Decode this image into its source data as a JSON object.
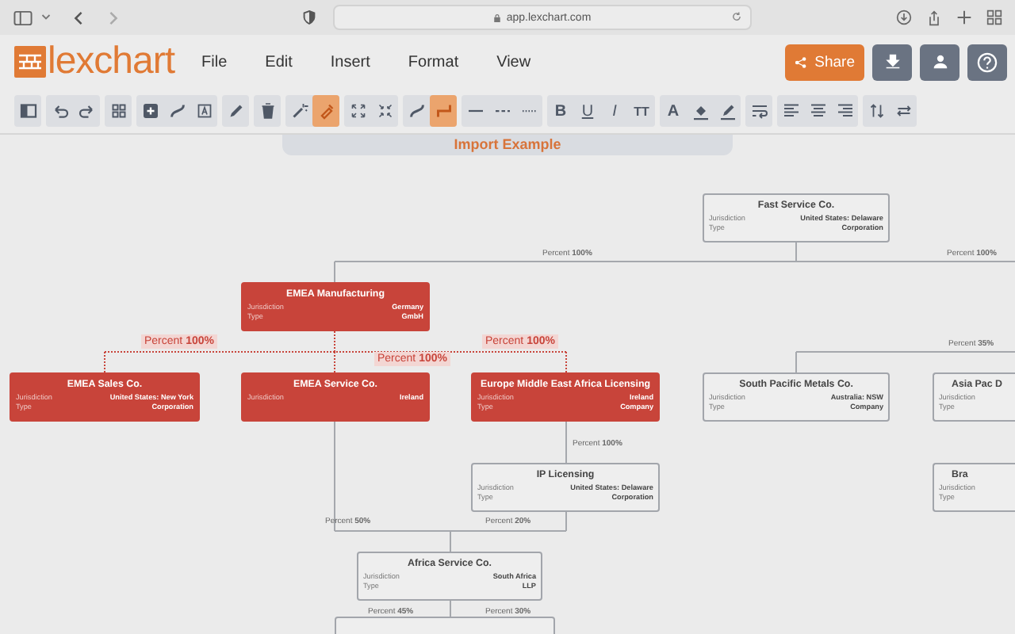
{
  "browser": {
    "url": "app.lexchart.com"
  },
  "logo": "lexchart",
  "menu": [
    "File",
    "Edit",
    "Insert",
    "Format",
    "View"
  ],
  "share_button": "Share",
  "toolbar": [
    [
      {
        "kind": "icon",
        "selected": false
      }
    ],
    [
      {
        "kind": "icon",
        "selected": false
      },
      {
        "kind": "icon",
        "selected": false
      }
    ],
    [
      {
        "kind": "icon",
        "selected": false
      }
    ],
    [
      {
        "kind": "icon",
        "selected": false
      },
      {
        "kind": "icon",
        "selected": false
      },
      {
        "kind": "icon",
        "selected": false
      }
    ],
    [
      {
        "kind": "icon",
        "selected": false
      }
    ],
    [
      {
        "kind": "icon",
        "selected": false
      }
    ],
    [
      {
        "kind": "icon",
        "selected": false
      },
      {
        "kind": "icon",
        "selected": true
      }
    ],
    [
      {
        "kind": "icon",
        "selected": false
      },
      {
        "kind": "icon",
        "selected": false
      }
    ],
    [
      {
        "kind": "icon",
        "selected": false
      },
      {
        "kind": "icon",
        "selected": true
      }
    ],
    [
      {
        "kind": "icon",
        "selected": false
      },
      {
        "kind": "icon",
        "selected": false
      },
      {
        "kind": "icon",
        "selected": false
      }
    ],
    [
      {
        "kind": "text",
        "label": "B",
        "selected": false
      },
      {
        "kind": "text",
        "label": "U",
        "selected": false
      },
      {
        "kind": "text",
        "label": "I",
        "selected": false
      },
      {
        "kind": "text",
        "label": "TT",
        "selected": false
      }
    ],
    [
      {
        "kind": "text",
        "label": "A",
        "selected": false
      },
      {
        "kind": "icon",
        "selected": false
      },
      {
        "kind": "icon",
        "selected": false
      }
    ],
    [
      {
        "kind": "icon",
        "selected": false
      }
    ],
    [
      {
        "kind": "icon",
        "selected": false
      },
      {
        "kind": "icon",
        "selected": false
      },
      {
        "kind": "icon",
        "selected": false
      }
    ],
    [
      {
        "kind": "icon",
        "selected": false
      },
      {
        "kind": "icon",
        "selected": false
      }
    ]
  ],
  "document_tab": "Import Example",
  "nodes": [
    {
      "title": "Fast Service Co.",
      "highlighted": false,
      "rows": [
        {
          "label": "Jurisdiction",
          "value": "United States: Delaware"
        },
        {
          "label": "Type",
          "value": "Corporation"
        }
      ]
    },
    {
      "title": "EMEA Manufacturing",
      "highlighted": true,
      "rows": [
        {
          "label": "Jurisdiction",
          "value": "Germany"
        },
        {
          "label": "Type",
          "value": "GmbH"
        }
      ]
    },
    {
      "title": "EMEA Sales Co.",
      "highlighted": true,
      "rows": [
        {
          "label": "Jurisdiction",
          "value": "United States: New York"
        },
        {
          "label": "Type",
          "value": "Corporation"
        }
      ]
    },
    {
      "title": "EMEA Service Co.",
      "highlighted": true,
      "rows": [
        {
          "label": "Jurisdiction",
          "value": "Ireland"
        }
      ]
    },
    {
      "title": "Europe Middle East Africa Licensing",
      "highlighted": true,
      "rows": [
        {
          "label": "Jurisdiction",
          "value": "Ireland"
        },
        {
          "label": "Type",
          "value": "Company"
        }
      ]
    },
    {
      "title": "South Pacific Metals Co.",
      "highlighted": false,
      "rows": [
        {
          "label": "Jurisdiction",
          "value": "Australia: NSW"
        },
        {
          "label": "Type",
          "value": "Company"
        }
      ]
    },
    {
      "title": "Asia Pac D",
      "highlighted": false,
      "rows": [
        {
          "label": "Jurisdiction"
        },
        {
          "label": "Type"
        }
      ]
    },
    {
      "title": "IP Licensing",
      "highlighted": false,
      "rows": [
        {
          "label": "Jurisdiction",
          "value": "United States: Delaware"
        },
        {
          "label": "Type",
          "value": "Corporation"
        }
      ]
    },
    {
      "title": "Bra",
      "highlighted": false,
      "rows": [
        {
          "label": "Jurisdiction"
        },
        {
          "label": "Type"
        }
      ]
    },
    {
      "title": "Africa Service Co.",
      "highlighted": false,
      "rows": [
        {
          "label": "Jurisdiction",
          "value": "South Africa"
        },
        {
          "label": "Type",
          "value": "LLP"
        }
      ]
    }
  ],
  "edge_labels": [
    {
      "text": "Percent **100%**",
      "highlighted": false
    },
    {
      "text": "Percent **100%**",
      "highlighted": false
    },
    {
      "text": "Percent **100%**",
      "highlighted": true
    },
    {
      "text": "Percent **100%**",
      "highlighted": true
    },
    {
      "text": "Percent **35%**",
      "highlighted": false
    },
    {
      "text": "Percent **100%**",
      "highlighted": true
    },
    {
      "text": "Percent **100%**",
      "highlighted": false
    },
    {
      "text": "Percent **50%**",
      "highlighted": false
    },
    {
      "text": "Percent **20%**",
      "highlighted": false
    },
    {
      "text": "Percent **45%**",
      "highlighted": false
    },
    {
      "text": "Percent **30%**",
      "highlighted": false
    }
  ]
}
